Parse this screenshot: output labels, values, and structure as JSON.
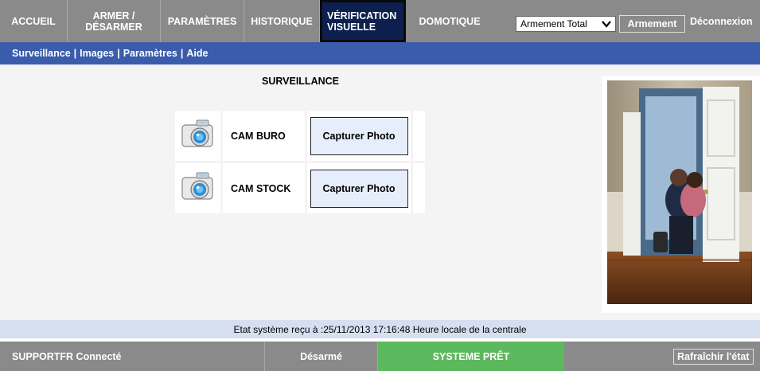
{
  "nav": {
    "items": [
      {
        "label": "ACCUEIL"
      },
      {
        "label": "ARMER / DÉSARMER"
      },
      {
        "label": "PARAMÈTRES"
      },
      {
        "label": "HISTORIQUE"
      },
      {
        "label": "VÉRIFICATION VISUELLE"
      },
      {
        "label": "DOMOTIQUE"
      }
    ],
    "arm_select_value": "Armement Total",
    "arm_button": "Armement",
    "logout": "Déconnexion"
  },
  "subnav": {
    "links": [
      "Surveillance",
      "Images",
      "Paramètres",
      "Aide"
    ],
    "separator": "|"
  },
  "main": {
    "title": "SURVEILLANCE",
    "cameras": [
      {
        "name": "CAM BURO",
        "capture_label": "Capturer Photo"
      },
      {
        "name": "CAM STOCK",
        "capture_label": "Capturer Photo"
      }
    ]
  },
  "status": {
    "text": "Etat système reçu à :25/11/2013 17:16:48 Heure locale de la centrale"
  },
  "footer": {
    "user": "SUPPORTFR Connecté",
    "state": "Désarmé",
    "ready": "SYSTEME PRÊT",
    "refresh": "Rafraîchir l'état"
  },
  "colors": {
    "nav_bg": "#8a8a8a",
    "nav_active": "#0d1f4f",
    "subnav_bg": "#3a5cab",
    "status_bg": "#d6dff0",
    "ready_green": "#5cb85c",
    "capture_btn_bg": "#e7eefb"
  },
  "icons": {
    "camera": "camera-icon",
    "select_arrow": "chevron-down-icon"
  }
}
